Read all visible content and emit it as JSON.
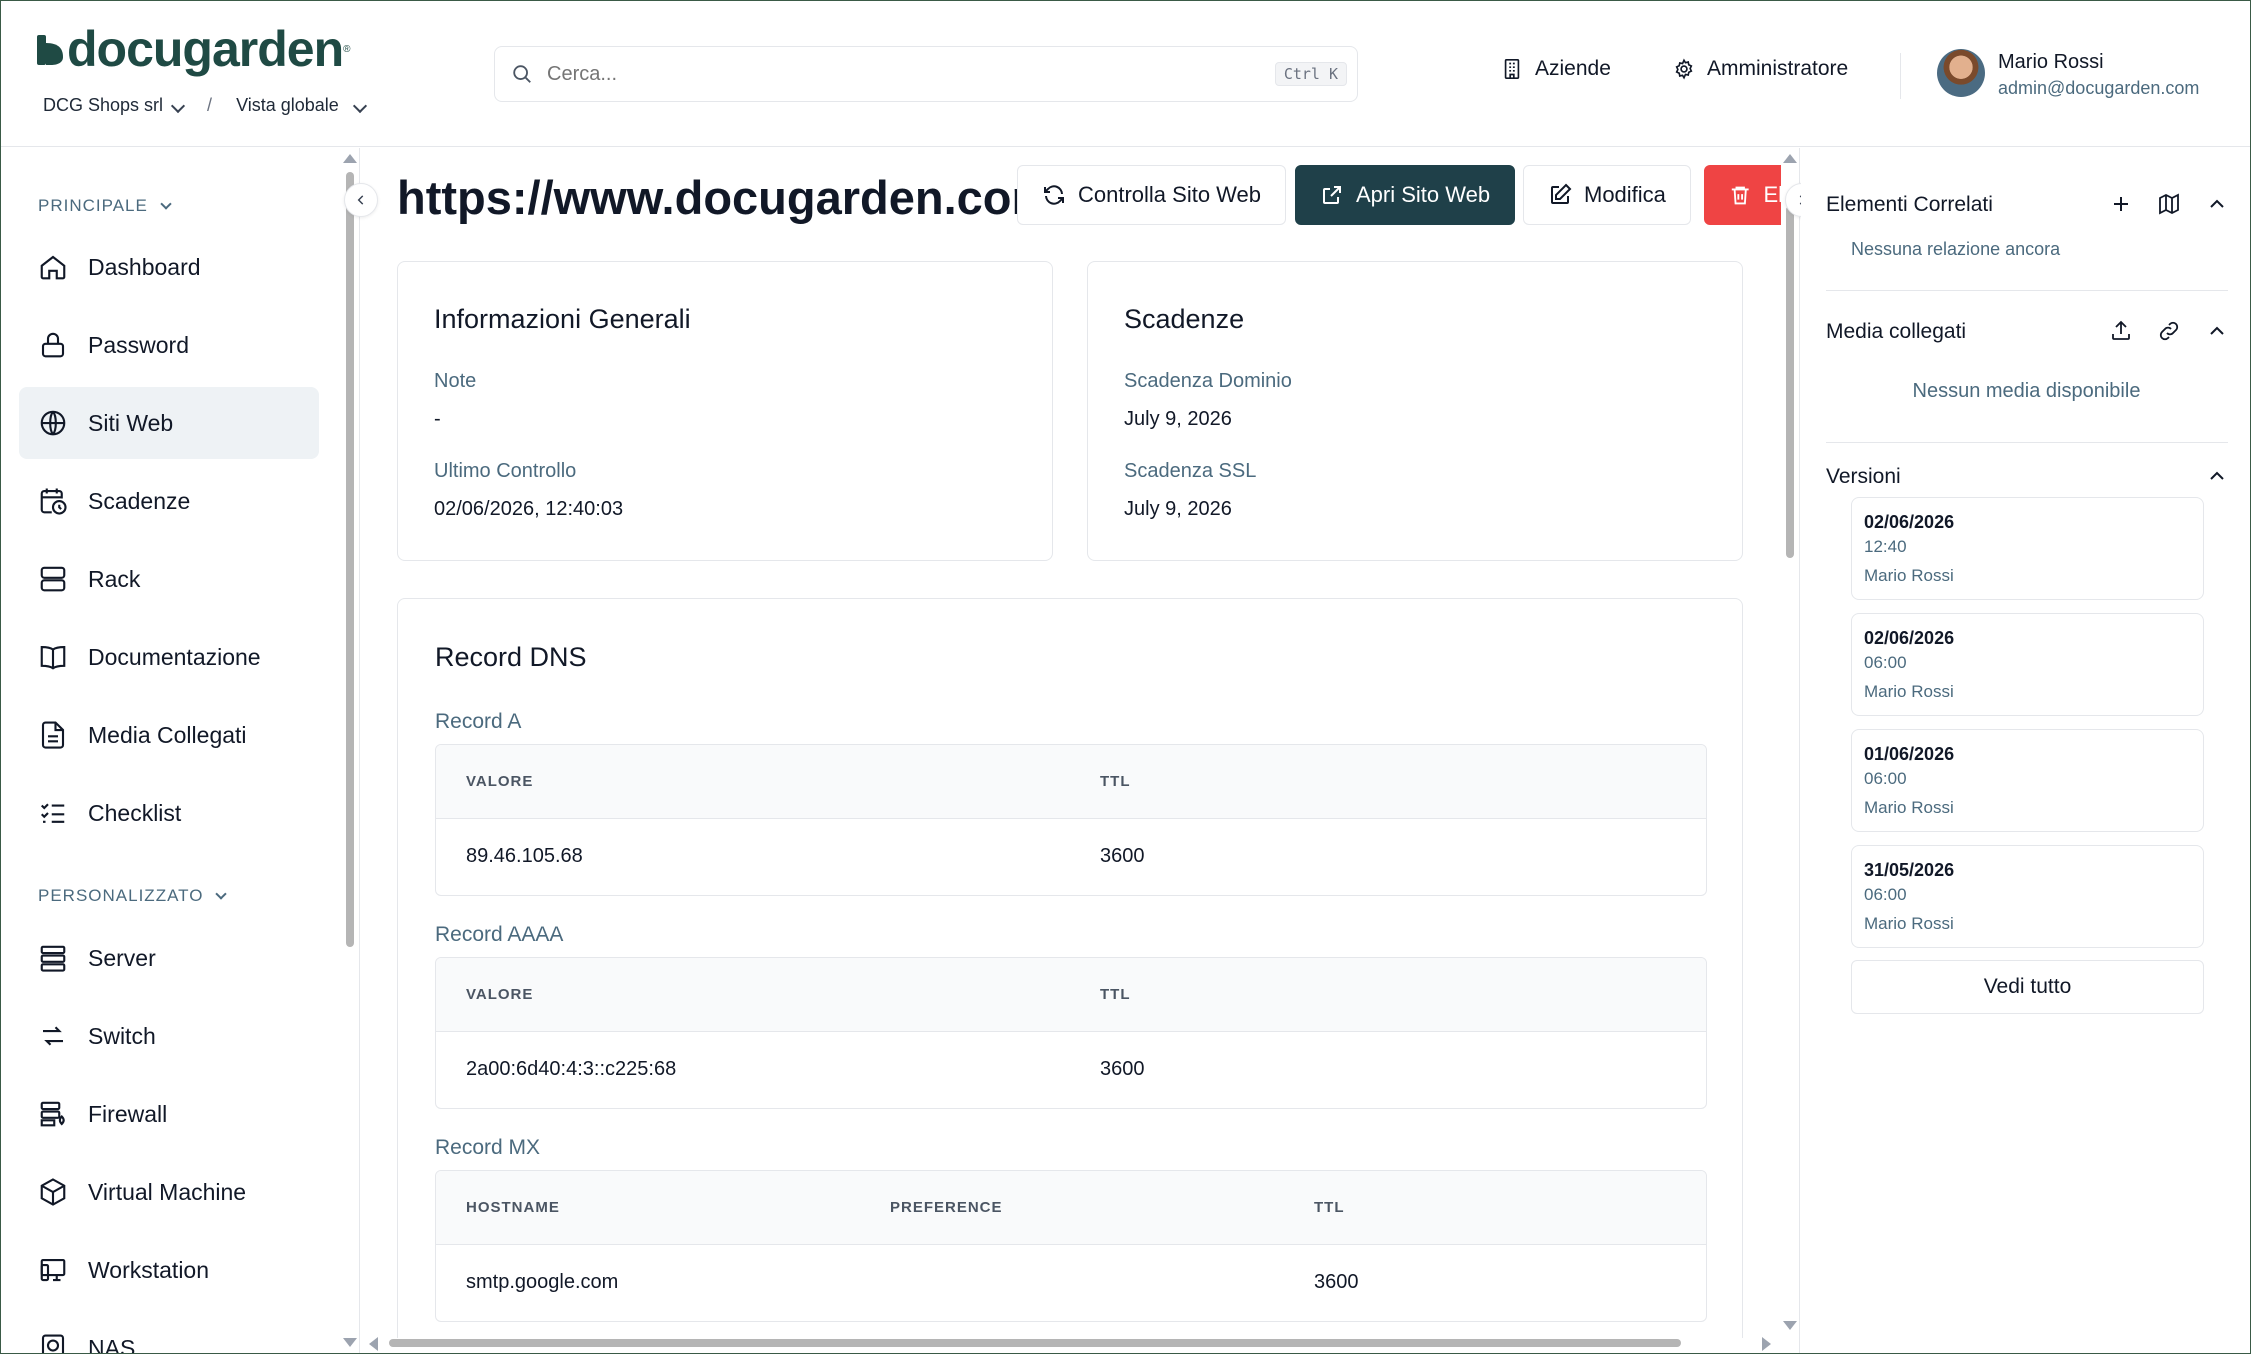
{
  "brand": {
    "logo_text": "docugarden",
    "accent": "#1f4a44"
  },
  "header": {
    "breadcrumb": {
      "company": "DCG Shops srl",
      "separator": "/",
      "view": "Vista globale"
    },
    "search": {
      "placeholder": "Cerca...",
      "shortcut": "Ctrl K"
    },
    "nav": {
      "companies": "Aziende",
      "admin": "Amministratore"
    },
    "user": {
      "name": "Mario Rossi",
      "email": "admin@docugarden.com"
    }
  },
  "sidebar": {
    "section_main": "PRINCIPALE",
    "main_items": [
      {
        "label": "Dashboard",
        "icon": "home-icon"
      },
      {
        "label": "Password",
        "icon": "lock-icon"
      },
      {
        "label": "Siti Web",
        "icon": "globe-icon",
        "active": true
      },
      {
        "label": "Scadenze",
        "icon": "calendar-clock-icon"
      },
      {
        "label": "Rack",
        "icon": "server-rack-icon"
      },
      {
        "label": "Documentazione",
        "icon": "book-icon"
      },
      {
        "label": "Media Collegati",
        "icon": "file-icon"
      },
      {
        "label": "Checklist",
        "icon": "checklist-icon"
      }
    ],
    "section_custom": "PERSONALIZZATO",
    "custom_items": [
      {
        "label": "Server",
        "icon": "server-icon"
      },
      {
        "label": "Switch",
        "icon": "switch-icon"
      },
      {
        "label": "Firewall",
        "icon": "firewall-icon"
      },
      {
        "label": "Virtual Machine",
        "icon": "cube-icon"
      },
      {
        "label": "Workstation",
        "icon": "workstation-icon"
      },
      {
        "label": "NAS",
        "icon": "nas-icon"
      }
    ]
  },
  "page": {
    "title": "https://www.docugarden.com",
    "actions": {
      "check": "Controlla Sito Web",
      "open": "Apri Sito Web",
      "edit": "Modifica",
      "delete": "El"
    },
    "general": {
      "title": "Informazioni Generali",
      "note_label": "Note",
      "note_value": "-",
      "last_check_label": "Ultimo Controllo",
      "last_check_value": "02/06/2026, 12:40:03"
    },
    "deadlines": {
      "title": "Scadenze",
      "domain_label": "Scadenza Dominio",
      "domain_value": "July 9, 2026",
      "ssl_label": "Scadenza SSL",
      "ssl_value": "July 9, 2026"
    },
    "dns": {
      "title": "Record DNS",
      "a": {
        "label": "Record A",
        "col_value": "VALORE",
        "col_ttl": "TTL",
        "value": "89.46.105.68",
        "ttl": "3600"
      },
      "aaaa": {
        "label": "Record AAAA",
        "col_value": "VALORE",
        "col_ttl": "TTL",
        "value": "2a00:6d40:4:3::c225:68",
        "ttl": "3600"
      },
      "mx": {
        "label": "Record MX",
        "col_host": "HOSTNAME",
        "col_pref": "PREFERENCE",
        "col_ttl": "TTL",
        "host": "smtp.google.com",
        "pref": "",
        "ttl": "3600"
      }
    }
  },
  "right_panel": {
    "related": {
      "title": "Elementi Correlati",
      "empty": "Nessuna relazione ancora"
    },
    "media": {
      "title": "Media collegati",
      "empty": "Nessun media disponibile"
    },
    "versions": {
      "title": "Versioni",
      "items": [
        {
          "date": "02/06/2026",
          "time": "12:40",
          "user": "Mario Rossi"
        },
        {
          "date": "02/06/2026",
          "time": "06:00",
          "user": "Mario Rossi"
        },
        {
          "date": "01/06/2026",
          "time": "06:00",
          "user": "Mario Rossi"
        },
        {
          "date": "31/05/2026",
          "time": "06:00",
          "user": "Mario Rossi"
        }
      ],
      "see_all": "Vedi tutto"
    }
  }
}
